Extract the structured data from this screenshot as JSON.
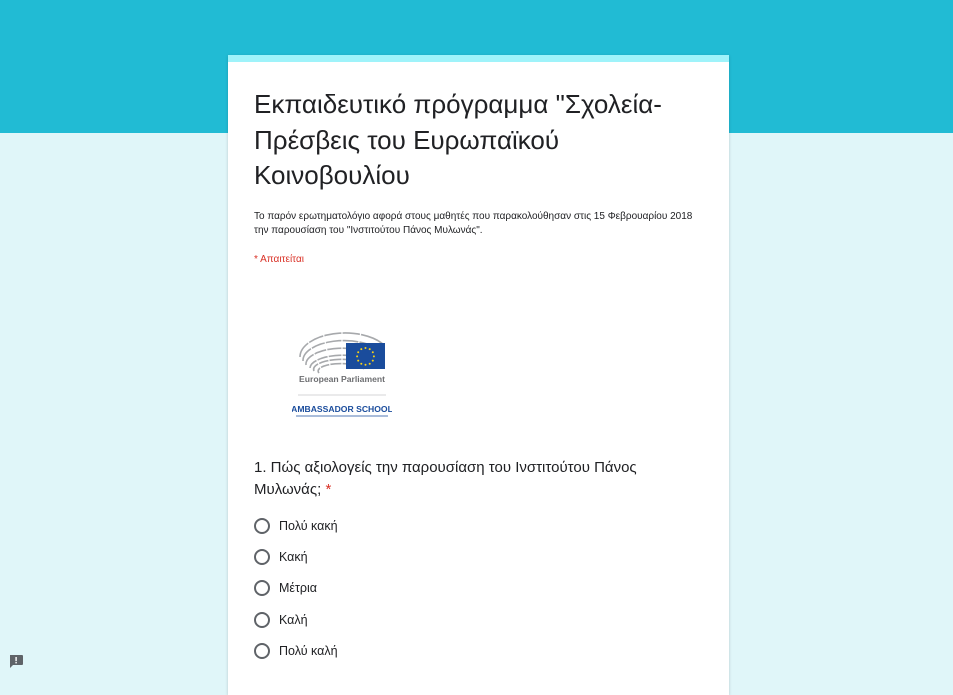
{
  "form": {
    "title": "Εκπαιδευτικό πρόγραμμα \"Σχολεία-Πρέσβεις του Ευρωπαϊκού Κοινοβουλίου",
    "description": "Το παρόν ερωτηματολόγιο αφορά στους μαθητές που παρακολούθησαν στις 15 Φεβρουαρίου 2018 την παρουσίαση του \"Ινστιτούτου Πάνος Μυλωνάς\".",
    "required_note": "* Απαιτείται"
  },
  "logo": {
    "line1": "European Parliament",
    "line2": "AMBASSADOR SCHOOL",
    "flag_color": "#1a4c9c",
    "star_color": "#f7d117"
  },
  "question": {
    "title": "1. Πώς αξιολογείς την παρουσίαση του Ινστιτούτου Πάνος Μυλωνάς;",
    "required_marker": "*",
    "options": [
      {
        "label": "Πολύ κακή"
      },
      {
        "label": "Κακή"
      },
      {
        "label": "Μέτρια"
      },
      {
        "label": "Καλή"
      },
      {
        "label": "Πολύ καλή"
      }
    ]
  },
  "colors": {
    "header_band": "#21bbd4",
    "page_background": "#e0f6f9",
    "card_accent": "#9ff3fa",
    "required": "#d93025"
  },
  "icons": {
    "feedback": "report-feedback-icon"
  }
}
